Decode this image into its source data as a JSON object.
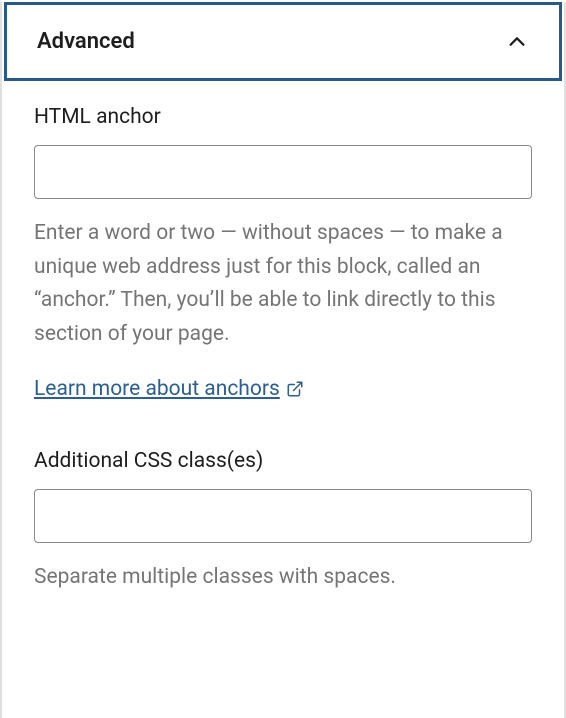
{
  "panel": {
    "title": "Advanced"
  },
  "anchor": {
    "label": "HTML anchor",
    "value": "",
    "help": "Enter a word or two — without spaces — to make a unique web address just for this block, called an “anchor.” Then, you’ll be able to link directly to this section of your page.",
    "link_text": "Learn more about anchors"
  },
  "css": {
    "label": "Additional CSS class(es)",
    "value": "",
    "help": "Separate multiple classes with spaces."
  }
}
